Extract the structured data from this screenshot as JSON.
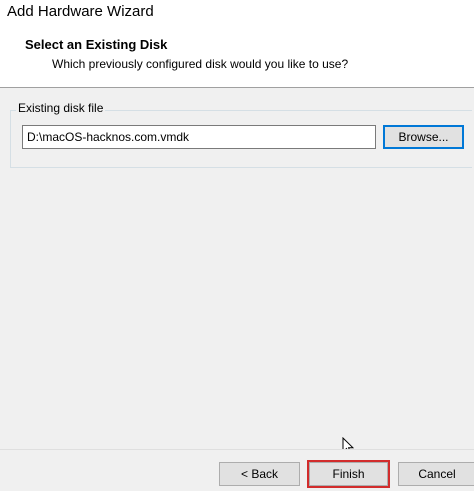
{
  "window": {
    "title": "Add Hardware Wizard"
  },
  "header": {
    "title": "Select an Existing Disk",
    "subtitle": "Which previously configured disk would you like to use?"
  },
  "group": {
    "legend": "Existing disk file",
    "path_value": "D:\\macOS-hacknos.com.vmdk",
    "browse_label": "Browse..."
  },
  "footer": {
    "back_label": "< Back",
    "finish_label": "Finish",
    "cancel_label": "Cancel"
  },
  "colors": {
    "focus_border": "#0078d7",
    "highlight_outline": "#d22c2c"
  },
  "icons": {
    "pointer": "mouse-cursor-icon"
  }
}
